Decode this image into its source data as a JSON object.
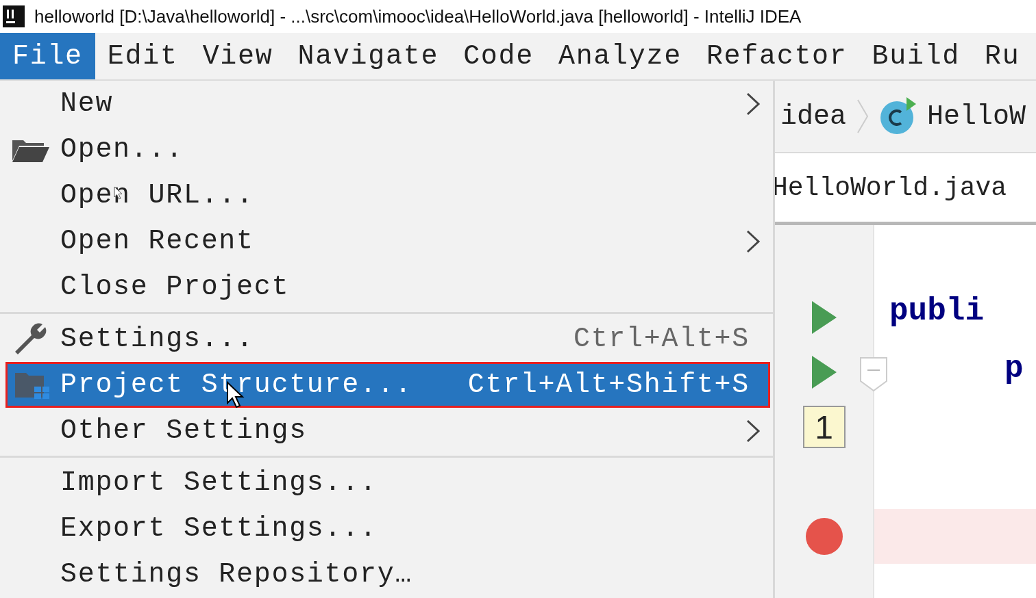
{
  "title_bar": {
    "title": "helloworld [D:\\Java\\helloworld] - ...\\src\\com\\imooc\\idea\\HelloWorld.java [helloworld] - IntelliJ IDEA"
  },
  "menu_bar": [
    {
      "label": "File",
      "selected": true
    },
    {
      "label": "Edit",
      "selected": false
    },
    {
      "label": "View",
      "selected": false
    },
    {
      "label": "Navigate",
      "selected": false
    },
    {
      "label": "Code",
      "selected": false
    },
    {
      "label": "Analyze",
      "selected": false
    },
    {
      "label": "Refactor",
      "selected": false
    },
    {
      "label": "Build",
      "selected": false
    },
    {
      "label": "Ru",
      "selected": false
    }
  ],
  "file_menu": [
    {
      "kind": "plain",
      "label": "New",
      "submenu": true,
      "selected": false
    },
    {
      "kind": "folder",
      "label": "Open...",
      "selected": false
    },
    {
      "kind": "plain",
      "label": "Open URL...",
      "selected": false
    },
    {
      "kind": "plain",
      "label": "Open Recent",
      "submenu": true,
      "selected": false
    },
    {
      "kind": "plain",
      "label": "Close Project",
      "selected": false
    },
    {
      "kind": "separator"
    },
    {
      "kind": "wrench",
      "label": "Settings...",
      "shortcut": "Ctrl+Alt+S",
      "selected": false
    },
    {
      "kind": "structure",
      "label": "Project Structure...",
      "shortcut": "Ctrl+Alt+Shift+S",
      "selected": true
    },
    {
      "kind": "plain",
      "label": "Other Settings",
      "submenu": true,
      "selected": false
    },
    {
      "kind": "separator"
    },
    {
      "kind": "plain",
      "label": "Import Settings...",
      "selected": false
    },
    {
      "kind": "plain",
      "label": "Export Settings...",
      "selected": false
    },
    {
      "kind": "plain",
      "label": "Settings Repository…",
      "selected": false
    }
  ],
  "breadcrumb": [
    "idea",
    "HelloW"
  ],
  "editor_tab": {
    "label": "HelloWorld.java"
  },
  "gutter": [
    {
      "kind": "run"
    },
    {
      "kind": "run"
    },
    {
      "kind": "line_number",
      "label": "1"
    },
    {
      "kind": "breakpoint"
    }
  ],
  "code_lines": [
    {
      "text": "publi"
    },
    {
      "text": "p"
    }
  ]
}
